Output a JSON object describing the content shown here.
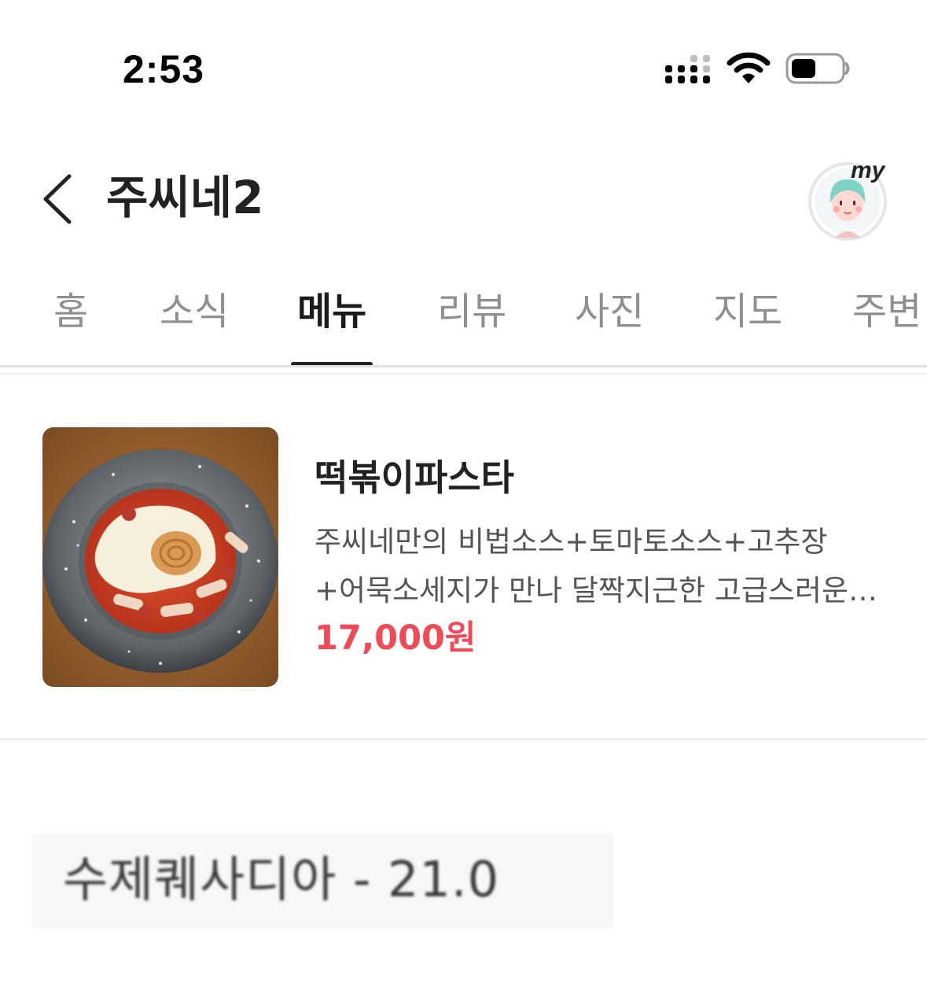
{
  "status_bar": {
    "time": "2:53",
    "signal_icon": "cellular-signal-icon",
    "wifi_icon": "wifi-icon",
    "battery_icon": "battery-icon"
  },
  "header": {
    "back_icon": "chevron-left-icon",
    "title": "주씨네2",
    "my_label": "my",
    "my_icon": "avatar-icon"
  },
  "tabs": [
    {
      "label": "홈",
      "active": false
    },
    {
      "label": "소식",
      "active": false
    },
    {
      "label": "메뉴",
      "active": true
    },
    {
      "label": "리뷰",
      "active": false
    },
    {
      "label": "사진",
      "active": false
    },
    {
      "label": "지도",
      "active": false
    },
    {
      "label": "주변",
      "active": false
    }
  ],
  "menu": {
    "items": [
      {
        "name": "떡볶이파스타",
        "description": "주씨네만의 비법소스+토마토소스+고추장+어묵소세지가 만나 달짝지근한 고급스러운 떡볶이파스타",
        "price": "17,000원",
        "photo_icon": "food-photo"
      }
    ],
    "next_section_heading": "수제퀘사디아 - 21.0"
  },
  "colors": {
    "accent_price": "#ef4a55",
    "active_tab": "#1b1b1b",
    "inactive_tab": "#8f8f8f",
    "avatar_hair": "#7fd3c4"
  }
}
